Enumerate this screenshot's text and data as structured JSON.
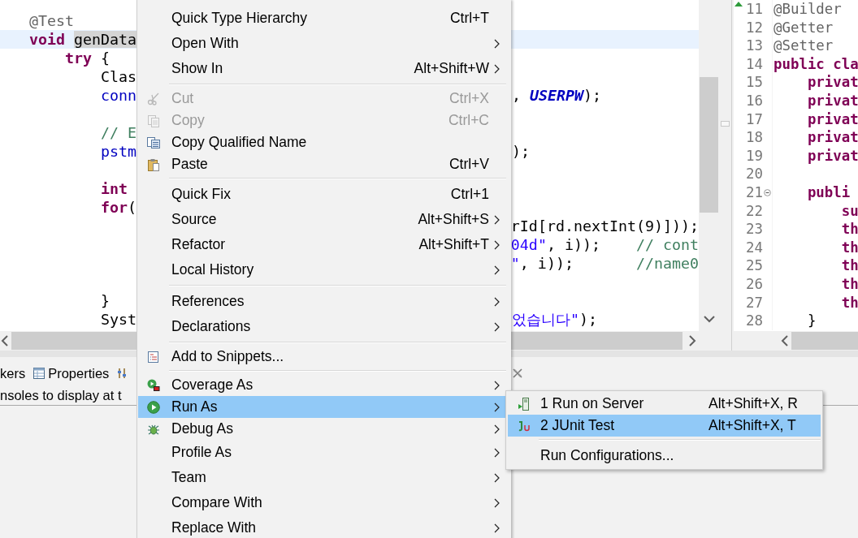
{
  "editor": {
    "lines": [
      {
        "current": false,
        "left": [
          {
            "kind": "annotation",
            "text": "@Test"
          }
        ]
      },
      {
        "current": true,
        "left": [
          {
            "kind": "keyword",
            "text": "void "
          },
          {
            "kind": "occurrence",
            "text": "genData"
          }
        ]
      },
      {
        "current": false,
        "left": [
          {
            "kind": "keyword",
            "text": "    try"
          },
          {
            "kind": "plain",
            "text": " {"
          }
        ]
      },
      {
        "current": false,
        "left": [
          {
            "kind": "plain",
            "text": "        Clas"
          }
        ]
      },
      {
        "current": false,
        "left": [
          {
            "kind": "field",
            "text": "        conn"
          }
        ],
        "right": [
          {
            "kind": "plain",
            "text": ", "
          },
          {
            "kind": "constant",
            "text": "USERPW"
          },
          {
            "kind": "plain",
            "text": ");"
          }
        ]
      },
      {
        "current": false
      },
      {
        "current": false,
        "left": [
          {
            "kind": "comment",
            "text": "        // E"
          }
        ]
      },
      {
        "current": false,
        "left": [
          {
            "kind": "field",
            "text": "        pstm"
          }
        ],
        "right": [
          {
            "kind": "plain",
            "text": ");"
          }
        ]
      },
      {
        "current": false
      },
      {
        "current": false,
        "left": [
          {
            "kind": "keyword",
            "text": "        int"
          }
        ]
      },
      {
        "current": false,
        "left": [
          {
            "kind": "keyword",
            "text": "        for"
          },
          {
            "kind": "plain",
            "text": "("
          }
        ]
      },
      {
        "current": false,
        "right": [
          {
            "kind": "plain",
            "text": "rId[rd.nextInt(9)]));"
          }
        ]
      },
      {
        "current": false,
        "right": [
          {
            "kind": "string",
            "text": "04d\""
          },
          {
            "kind": "plain",
            "text": ", i));    "
          },
          {
            "kind": "comment",
            "text": "// cont"
          }
        ]
      },
      {
        "current": false,
        "right": [
          {
            "kind": "string",
            "text": "\""
          },
          {
            "kind": "plain",
            "text": ", i));       "
          },
          {
            "kind": "comment",
            "text": "//name0"
          }
        ]
      },
      {
        "current": false
      },
      {
        "current": false,
        "left": [
          {
            "kind": "plain",
            "text": "        }"
          }
        ]
      },
      {
        "current": false,
        "left": [
          {
            "kind": "plain",
            "text": "        Syst"
          }
        ],
        "right": [
          {
            "kind": "string",
            "text": "었습니다\""
          },
          {
            "kind": "plain",
            "text": ");"
          }
        ]
      }
    ]
  },
  "side_editor": {
    "lines": [
      {
        "number": "11",
        "fold": false,
        "tokens": [
          {
            "kind": "annotation",
            "text": "@Builder"
          }
        ]
      },
      {
        "number": "12",
        "fold": false,
        "tokens": [
          {
            "kind": "annotation",
            "text": "@Getter"
          }
        ]
      },
      {
        "number": "13",
        "fold": false,
        "tokens": [
          {
            "kind": "annotation",
            "text": "@Setter"
          }
        ]
      },
      {
        "number": "14",
        "fold": false,
        "tokens": [
          {
            "kind": "keyword",
            "text": "public cla"
          }
        ]
      },
      {
        "number": "15",
        "fold": false,
        "tokens": [
          {
            "kind": "keyword",
            "text": "    privat"
          }
        ]
      },
      {
        "number": "16",
        "fold": false,
        "tokens": [
          {
            "kind": "keyword",
            "text": "    privat"
          }
        ]
      },
      {
        "number": "17",
        "fold": false,
        "tokens": [
          {
            "kind": "keyword",
            "text": "    privat"
          }
        ]
      },
      {
        "number": "18",
        "fold": false,
        "tokens": [
          {
            "kind": "keyword",
            "text": "    privat"
          }
        ]
      },
      {
        "number": "19",
        "fold": false,
        "tokens": [
          {
            "kind": "keyword",
            "text": "    privat"
          }
        ]
      },
      {
        "number": "20",
        "fold": false
      },
      {
        "number": "21",
        "fold": true,
        "tokens": [
          {
            "kind": "keyword",
            "text": "    publi"
          }
        ]
      },
      {
        "number": "22",
        "fold": false,
        "tokens": [
          {
            "kind": "keyword",
            "text": "        su"
          }
        ]
      },
      {
        "number": "23",
        "fold": false,
        "tokens": [
          {
            "kind": "keyword",
            "text": "        th"
          }
        ]
      },
      {
        "number": "24",
        "fold": false,
        "tokens": [
          {
            "kind": "keyword",
            "text": "        th"
          }
        ]
      },
      {
        "number": "25",
        "fold": false,
        "tokens": [
          {
            "kind": "keyword",
            "text": "        th"
          }
        ]
      },
      {
        "number": "26",
        "fold": false,
        "tokens": [
          {
            "kind": "keyword",
            "text": "        th"
          }
        ]
      },
      {
        "number": "27",
        "fold": false,
        "tokens": [
          {
            "kind": "keyword",
            "text": "        th"
          }
        ]
      },
      {
        "number": "28",
        "fold": false,
        "tokens": [
          {
            "kind": "plain",
            "text": "    }"
          }
        ]
      }
    ]
  },
  "bottom_panel": {
    "tabs": [
      {
        "label": "kers"
      },
      {
        "label": "Properties"
      }
    ],
    "message": "nsoles to display at t"
  },
  "context_menu": {
    "groups": [
      [
        {
          "label": "Quick Type Hierarchy",
          "shortcut": "Ctrl+T",
          "submenu": false,
          "disabled": false,
          "selected": false
        },
        {
          "label": "Open With",
          "submenu": true,
          "disabled": false,
          "selected": false
        },
        {
          "label": "Show In",
          "shortcut": "Alt+Shift+W",
          "submenu": true,
          "disabled": false,
          "selected": false
        }
      ],
      [
        {
          "label": "Cut",
          "shortcut": "Ctrl+X",
          "submenu": false,
          "disabled": true,
          "selected": false
        },
        {
          "label": "Copy",
          "shortcut": "Ctrl+C",
          "submenu": false,
          "disabled": true,
          "selected": false
        },
        {
          "label": "Copy Qualified Name",
          "submenu": false,
          "disabled": false,
          "selected": false
        },
        {
          "label": "Paste",
          "shortcut": "Ctrl+V",
          "submenu": false,
          "disabled": false,
          "selected": false
        }
      ],
      [
        {
          "label": "Quick Fix",
          "shortcut": "Ctrl+1",
          "submenu": false,
          "disabled": false,
          "selected": false
        },
        {
          "label": "Source",
          "shortcut": "Alt+Shift+S",
          "submenu": true,
          "disabled": false,
          "selected": false
        },
        {
          "label": "Refactor",
          "shortcut": "Alt+Shift+T",
          "submenu": true,
          "disabled": false,
          "selected": false
        },
        {
          "label": "Local History",
          "submenu": true,
          "disabled": false,
          "selected": false
        }
      ],
      [
        {
          "label": "References",
          "submenu": true,
          "disabled": false,
          "selected": false
        },
        {
          "label": "Declarations",
          "submenu": true,
          "disabled": false,
          "selected": false
        }
      ],
      [
        {
          "label": "Add to Snippets...",
          "submenu": false,
          "disabled": false,
          "selected": false
        }
      ],
      [
        {
          "label": "Coverage As",
          "submenu": true,
          "disabled": false,
          "selected": false
        },
        {
          "label": "Run As",
          "submenu": true,
          "disabled": false,
          "selected": true
        },
        {
          "label": "Debug As",
          "submenu": true,
          "disabled": false,
          "selected": false
        },
        {
          "label": "Profile As",
          "submenu": true,
          "disabled": false,
          "selected": false
        },
        {
          "label": "Team",
          "submenu": true,
          "disabled": false,
          "selected": false
        },
        {
          "label": "Compare With",
          "submenu": true,
          "disabled": false,
          "selected": false
        },
        {
          "label": "Replace With",
          "submenu": true,
          "disabled": false,
          "selected": false
        }
      ]
    ]
  },
  "submenu": {
    "groups": [
      [
        {
          "label": "1 Run on Server",
          "shortcut": "Alt+Shift+X, R",
          "selected": false
        },
        {
          "label": "2 JUnit Test",
          "shortcut": "Alt+Shift+X, T",
          "selected": true
        }
      ],
      [
        {
          "label": "Run Configurations...",
          "selected": false
        }
      ]
    ]
  }
}
